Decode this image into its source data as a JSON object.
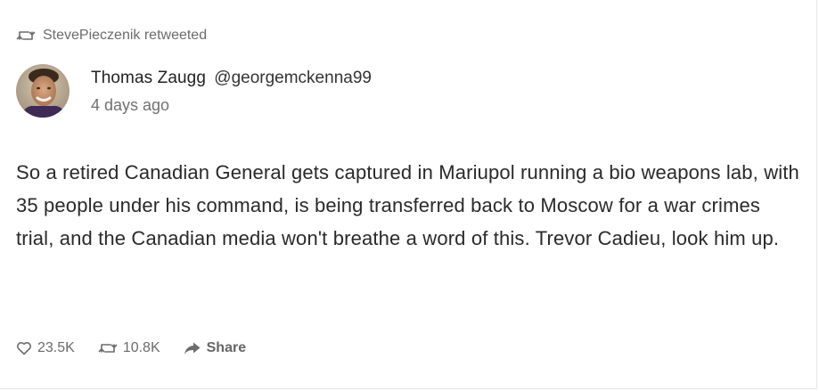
{
  "retweet": {
    "icon": "retweet-icon",
    "text": "StevePieczenik retweeted"
  },
  "post": {
    "author": {
      "display_name": "Thomas Zaugg",
      "handle": "@georgemckenna99",
      "avatar": "avatar-photo"
    },
    "timestamp": "4 days ago",
    "body": "So a retired Canadian General gets captured in Mariupol running a bio weapons lab, with 35 people under his command, is being transferred back to Moscow for a war crimes trial, and the Canadian media won't breathe a word of this. Trevor Cadieu, look him up."
  },
  "actions": {
    "likes": {
      "icon": "heart-icon",
      "count": "23.5K"
    },
    "retweets": {
      "icon": "retweet-icon",
      "count": "10.8K"
    },
    "share": {
      "icon": "share-arrow-icon",
      "label": "Share"
    }
  },
  "colors": {
    "text_primary": "#2a2a2a",
    "text_muted": "#6b6b6b",
    "background": "#ffffff"
  }
}
